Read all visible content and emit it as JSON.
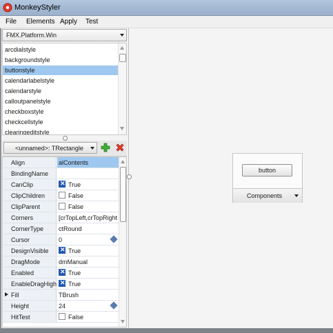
{
  "window": {
    "title": "MonkeyStyler"
  },
  "menubar": {
    "items": [
      "File",
      "Elements",
      "Apply",
      "Test"
    ]
  },
  "platform": {
    "selected": "FMX.Platform.Win"
  },
  "style_list": {
    "items": [
      "arcdialstyle",
      "backgroundstyle",
      "buttonstyle",
      "calendarlabelstyle",
      "calendarstyle",
      "calloutpanelstyle",
      "checkboxstyle",
      "checkcellstyle",
      "clearingeditstyle"
    ],
    "selected_index": 2
  },
  "object_selector": {
    "value": "<unnamed>: TRectangle"
  },
  "properties": [
    {
      "name": "Align",
      "value": "alContents",
      "selected": true
    },
    {
      "name": "BindingName",
      "value": ""
    },
    {
      "name": "CanClip",
      "value": "True",
      "checkbox": true,
      "checked": true
    },
    {
      "name": "ClipChildren",
      "value": "False",
      "checkbox": true,
      "checked": false
    },
    {
      "name": "ClipParent",
      "value": "False",
      "checkbox": true,
      "checked": false
    },
    {
      "name": "Corners",
      "value": "[crTopLeft,crTopRight"
    },
    {
      "name": "CornerType",
      "value": "ctRound"
    },
    {
      "name": "Cursor",
      "value": "0",
      "stepper": true
    },
    {
      "name": "DesignVisible",
      "value": "True",
      "checkbox": true,
      "checked": true
    },
    {
      "name": "DragMode",
      "value": "dmManual"
    },
    {
      "name": "Enabled",
      "value": "True",
      "checkbox": true,
      "checked": true
    },
    {
      "name": "EnableDragHigh",
      "value": "True",
      "checkbox": true,
      "checked": true
    },
    {
      "name": "Fill",
      "value": "TBrush",
      "expandable": true
    },
    {
      "name": "Height",
      "value": "24",
      "stepper": true
    },
    {
      "name": "HitTest",
      "value": "False",
      "checkbox": true,
      "checked": false
    }
  ],
  "preview": {
    "button_label": "button",
    "components_label": "Components"
  },
  "colors": {
    "selection": "#9ec8f0",
    "checkbox_on": "#1f57b4",
    "titlebar": "#a3b9d3"
  }
}
